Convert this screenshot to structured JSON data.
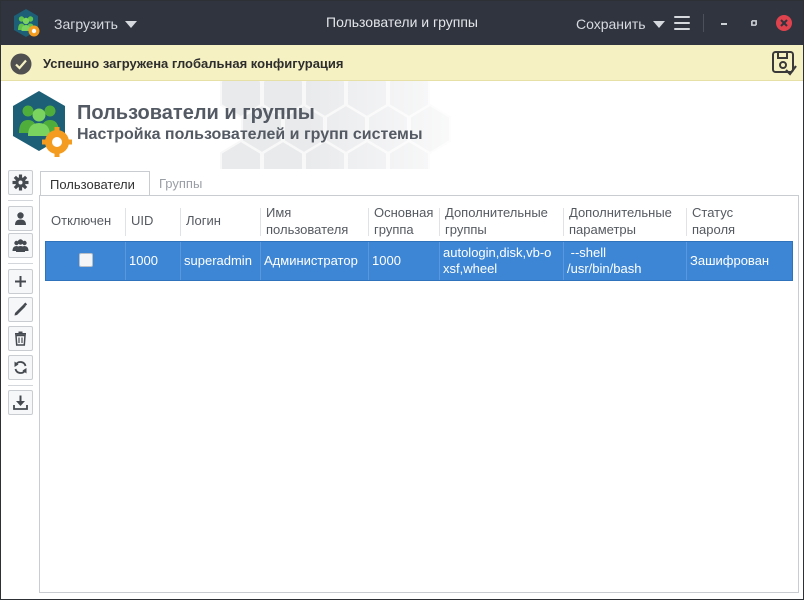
{
  "titlebar": {
    "load_label": "Загрузить",
    "title": "Пользователи и группы",
    "save_label": "Сохранить"
  },
  "notification": {
    "text": "Успешно загружена глобальная конфигурация"
  },
  "banner": {
    "title": "Пользователи и группы",
    "subtitle": "Настройка пользователей и групп системы"
  },
  "tabs": [
    {
      "label": "Пользователи",
      "active": true
    },
    {
      "label": "Группы",
      "active": false
    }
  ],
  "table": {
    "columns": [
      {
        "label": "Отключен"
      },
      {
        "label": "UID"
      },
      {
        "label": "Логин"
      },
      {
        "label": "Имя пользователя"
      },
      {
        "label": "Основная группа"
      },
      {
        "label": "Дополнительные группы"
      },
      {
        "label": "Дополнительные параметры"
      },
      {
        "label": "Статус пароля"
      }
    ],
    "rows": [
      {
        "disabled": false,
        "uid": "1000",
        "login": "superadmin",
        "name": "Администратор",
        "primary_group": "1000",
        "extra_groups": "autologin,disk,vb-oxsf,wheel",
        "extra_params": " --shell /usr/bin/bash",
        "password_status": "Зашифрован"
      }
    ]
  },
  "toolbar": {
    "icons": [
      "gear-icon",
      "user-icon",
      "group-icon",
      "add-icon",
      "edit-icon",
      "delete-icon",
      "refresh-icon",
      "download-icon"
    ]
  },
  "colors": {
    "titlebar_bg": "#2f343f",
    "notify_bg": "#f6f1c2",
    "selection": "#3d86d6",
    "close_red": "#e0424d",
    "brand_teal": "#1c5f77",
    "brand_green": "#62c24a",
    "brand_orange": "#f39c1f"
  }
}
